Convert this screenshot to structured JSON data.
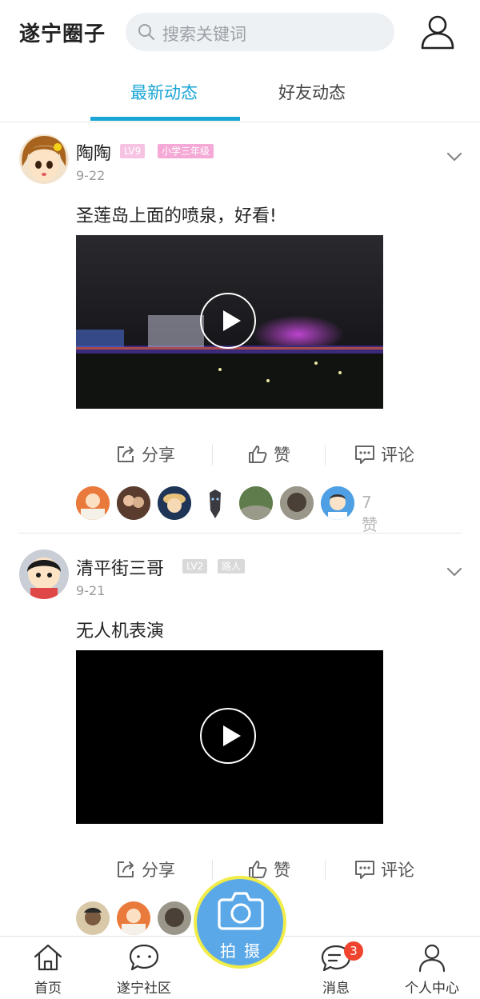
{
  "header": {
    "title": "遂宁圈子",
    "search_placeholder": "搜索关键词",
    "user_icon": "user-icon"
  },
  "tabs": [
    {
      "label": "最新动态",
      "active": true
    },
    {
      "label": "好友动态",
      "active": false
    }
  ],
  "colors": {
    "accent": "#1aa5d6",
    "badge_pink": "#f5a9d6",
    "badge_gray": "#cfcfcf",
    "fab_blue": "#5aa8e8",
    "fab_ring": "#f0ec4a",
    "message_badge": "#f0442f"
  },
  "posts": [
    {
      "username": "陶陶",
      "level": "LV9",
      "title_badge": "小学三年级",
      "date": "9-22",
      "text": "圣莲岛上面的喷泉，好看!",
      "actions": {
        "share": "分享",
        "like": "赞",
        "comment": "评论"
      },
      "likes_count": "7赞"
    },
    {
      "username": "清平街三哥",
      "level": "LV2",
      "title_badge": "路人",
      "date": "9-21",
      "text": "无人机表演",
      "actions": {
        "share": "分享",
        "like": "赞",
        "comment": "评论"
      }
    }
  ],
  "camera": {
    "label": "拍摄"
  },
  "bottom_nav": [
    {
      "label": "首页",
      "icon": "home-icon"
    },
    {
      "label": "遂宁社区",
      "icon": "chat-bubble-icon"
    },
    {
      "label": "消息",
      "icon": "message-icon",
      "badge": "3"
    },
    {
      "label": "个人中心",
      "icon": "user-icon"
    }
  ]
}
